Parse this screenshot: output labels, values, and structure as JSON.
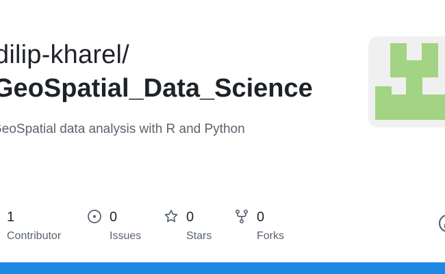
{
  "repo": {
    "owner": "dilip-kharel/",
    "name": "GeoSpatial_Data_Science",
    "description": "GeoSpatial data analysis with R and Python"
  },
  "avatar": {
    "icon": "identicon",
    "foreground_color": "#a2d483",
    "background_color": "#f0f0f0"
  },
  "stats": {
    "contributors": {
      "count": "1",
      "label": "Contributor"
    },
    "issues": {
      "count": "0",
      "label": "Issues",
      "icon": "issue-opened-icon"
    },
    "stars": {
      "count": "0",
      "label": "Stars",
      "icon": "star-icon"
    },
    "forks": {
      "count": "0",
      "label": "Forks",
      "icon": "repo-forked-icon"
    }
  },
  "colors": {
    "text_primary": "#1f2328",
    "text_secondary": "#59636e",
    "accent_bar": "#1f88e5"
  }
}
